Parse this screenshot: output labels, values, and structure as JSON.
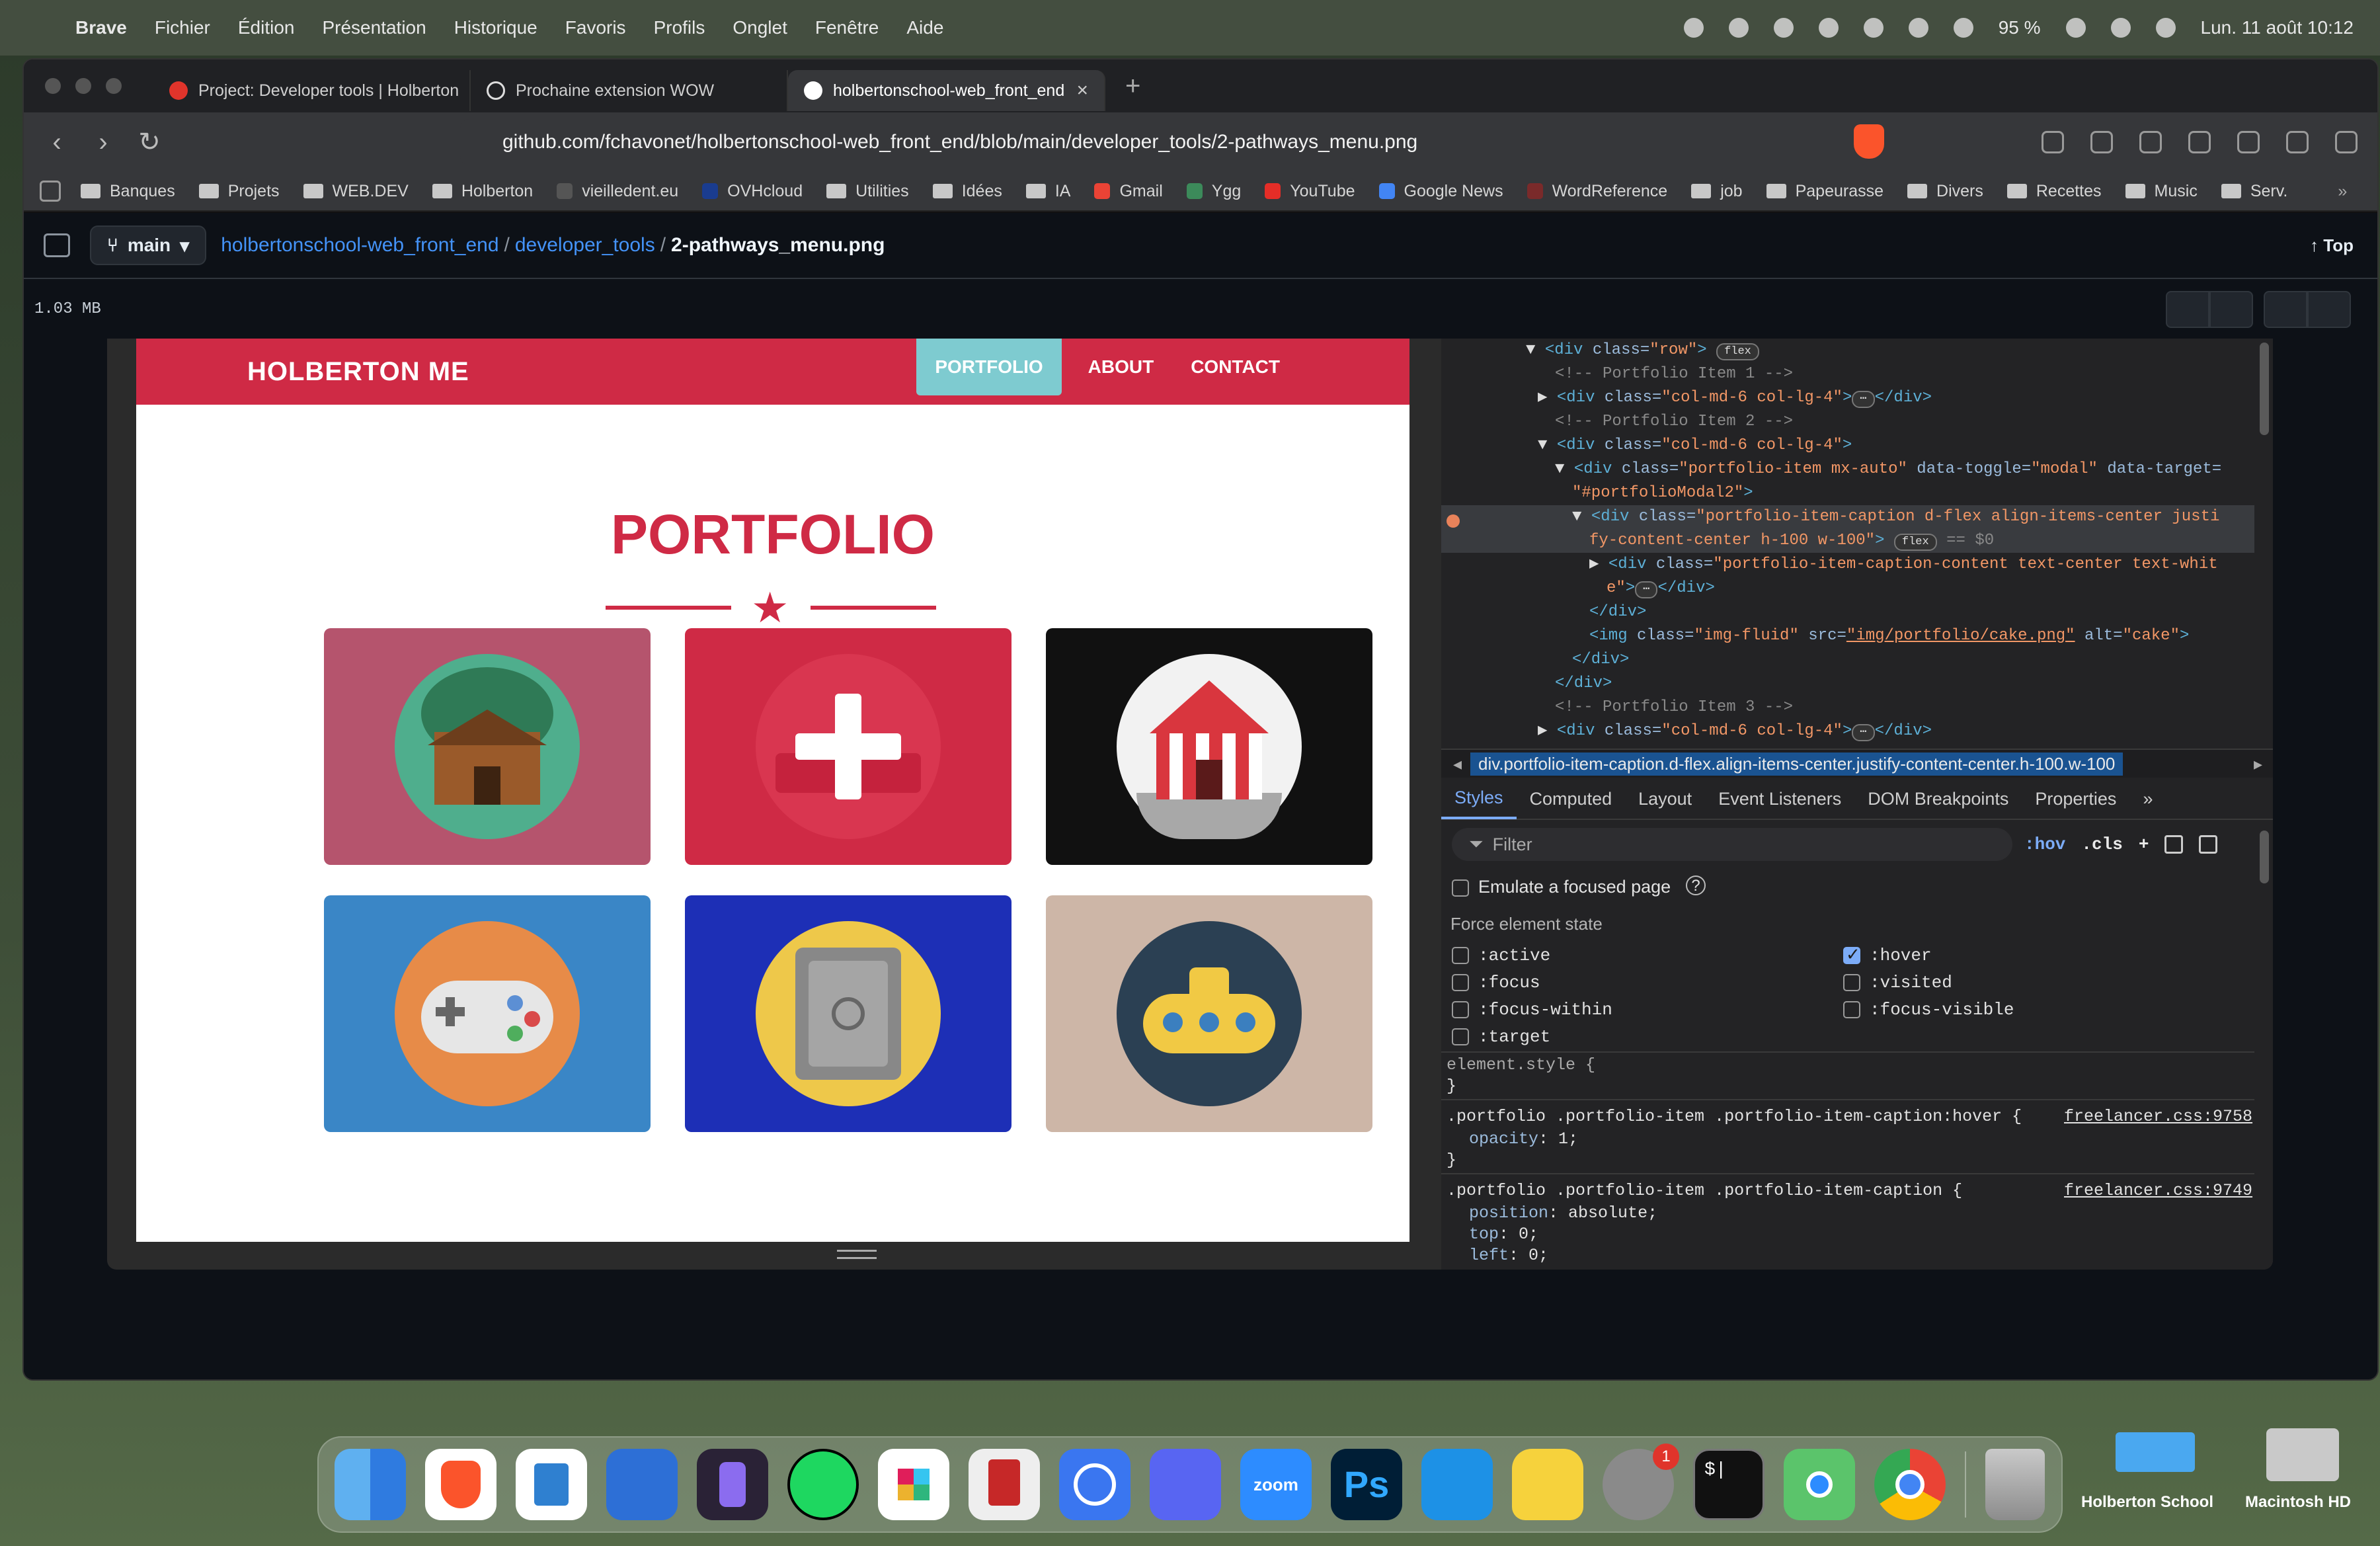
{
  "menubar": {
    "apple": "",
    "items": [
      "Brave",
      "Fichier",
      "Édition",
      "Présentation",
      "Historique",
      "Favoris",
      "Profils",
      "Onglet",
      "Fenêtre",
      "Aide"
    ],
    "battery": "95 %",
    "clock": "Lun. 11 août  10:12"
  },
  "browser": {
    "tabs": [
      {
        "title": "Project: Developer tools | Holberton"
      },
      {
        "title": "Prochaine extension WOW"
      },
      {
        "title": "holbertonschool-web_front_end"
      }
    ],
    "new_tab": "+",
    "close": "×",
    "url": "github.com/fchavonet/holbertonschool-web_front_end/blob/main/developer_tools/2-pathways_menu.png",
    "bookmarks": [
      "Banques",
      "Projets",
      "WEB.DEV",
      "Holberton",
      "vieilledent.eu",
      "OVHcloud",
      "Utilities",
      "Idées",
      "IA",
      "Gmail",
      "Ygg",
      "YouTube",
      "Google News",
      "WordReference",
      "job",
      "Papeurasse",
      "Divers",
      "Recettes",
      "Music",
      "Serv."
    ],
    "more": "»"
  },
  "github": {
    "branch": "main",
    "repo": "holbertonschool-web_front_end",
    "folder": "developer_tools",
    "file": "2-pathways_menu.png",
    "top": "Top",
    "size": "1.03 MB"
  },
  "site": {
    "brand": "HOLBERTON ME",
    "menu": [
      "PORTFOLIO",
      "ABOUT",
      "CONTACT"
    ],
    "title": "PORTFOLIO",
    "star": "★",
    "items": [
      "cabin",
      "cake",
      "circus",
      "game",
      "safe",
      "submarine"
    ]
  },
  "devtools": {
    "tree": {
      "l1a": "▼",
      "l1tag": "<div ",
      "l1att": "class=",
      "l1val": "\"row\"",
      "l1end": ">",
      "l1badge": "flex",
      "l2": "<!-- Portfolio Item 1 -->",
      "l3a": "▶",
      "l3tag": "<div ",
      "l3att": "class=",
      "l3val": "\"col-md-6 col-lg-4\"",
      "l3end": ">",
      "l3dots": "⋯",
      "l3close": "</div>",
      "l4": "<!-- Portfolio Item 2 -->",
      "l5a": "▼",
      "l5tag": "<div ",
      "l5att": "class=",
      "l5val": "\"col-md-6 col-lg-4\"",
      "l5end": ">",
      "l6a": "▼",
      "l6tag": "<div ",
      "l6att1": "class=",
      "l6val1": "\"portfolio-item mx-auto\"",
      "l6att2": " data-toggle=",
      "l6val2": "\"modal\"",
      "l6att3": " data-target=",
      "l7val": "\"#portfolioModal2\"",
      "l7end": ">",
      "l8a": "▼",
      "l8tag": "<div ",
      "l8att": "class=",
      "l8val": "\"portfolio-item-caption d-flex align-items-center justi",
      "l9val": "fy-content-center h-100 w-100\"",
      "l9end": ">",
      "l9badge": "flex",
      "l9eq": " == $0",
      "l10a": "▶",
      "l10tag": "<div ",
      "l10att": "class=",
      "l10val": "\"portfolio-item-caption-content text-center text-whit",
      "l11val": "e\"",
      "l11end": ">",
      "l11dots": "⋯",
      "l11close": "</div>",
      "l12": "</div>",
      "l13tag": "<img ",
      "l13att1": "class=",
      "l13val1": "\"img-fluid\"",
      "l13att2": " src=",
      "l13val2": "\"img/portfolio/cake.png\"",
      "l13att3": " alt=",
      "l13val3": "\"cake\"",
      "l13end": ">",
      "l14": "</div>",
      "l15": "</div>",
      "l16": "<!-- Portfolio Item 3 -->",
      "l17a": "▶",
      "l17tag": "<div ",
      "l17att": "class=",
      "l17val": "\"col-md-6 col-lg-4\"",
      "l17end": ">",
      "l17dots": "⋯",
      "l17close": "</div>"
    },
    "breadcrumb": "div.portfolio-item-caption.d-flex.align-items-center.justify-content-center.h-100.w-100",
    "tabs": [
      "Styles",
      "Computed",
      "Layout",
      "Event Listeners",
      "DOM Breakpoints",
      "Properties",
      "»"
    ],
    "filter_placeholder": "Filter",
    "hov": ":hov",
    "cls": ".cls",
    "plus": "+",
    "emulate": "Emulate a focused page",
    "force_state": "Force element state",
    "states": [
      ":active",
      ":focus",
      ":focus-within",
      ":target",
      ":hover",
      ":visited",
      ":focus-visible"
    ],
    "hover_checked": true,
    "element_style": "element.style {",
    "close_brace": "}",
    "rule1_sel": ".portfolio .portfolio-item .portfolio-item-caption:hover {",
    "rule1_src": "freelancer.css:9758",
    "rule1_prop": "opacity",
    "rule1_val": "1;",
    "rule2_sel": ".portfolio .portfolio-item .portfolio-item-caption {",
    "rule2_src": "freelancer.css:9749",
    "rule2_p1": "position",
    "rule2_v1": "absolute;",
    "rule2_p2": "top",
    "rule2_v2": "0;",
    "rule2_p3": "left",
    "rule2_v3": "0;"
  },
  "dock": {
    "apps": [
      "Finder",
      "Brave",
      "VS Code",
      "Xcode",
      "Obsidian",
      "Spotify",
      "Slack",
      "Transmission",
      "Signal",
      "Discord",
      "Zoom",
      "Photoshop",
      "Docker",
      "Cyberduck",
      "System Settings",
      "Terminal",
      "Find My",
      "Chrome",
      "Trash"
    ],
    "zoom": "zoom",
    "ps": "Ps",
    "terminal": "$|",
    "badge": "1",
    "labels": [
      "Holberton School",
      "Macintosh HD"
    ]
  },
  "colors": {
    "brand_red": "#cf2a45",
    "teal": "#7ecbd0",
    "devtools_bg": "#232325",
    "github_bg": "#0d1117"
  }
}
